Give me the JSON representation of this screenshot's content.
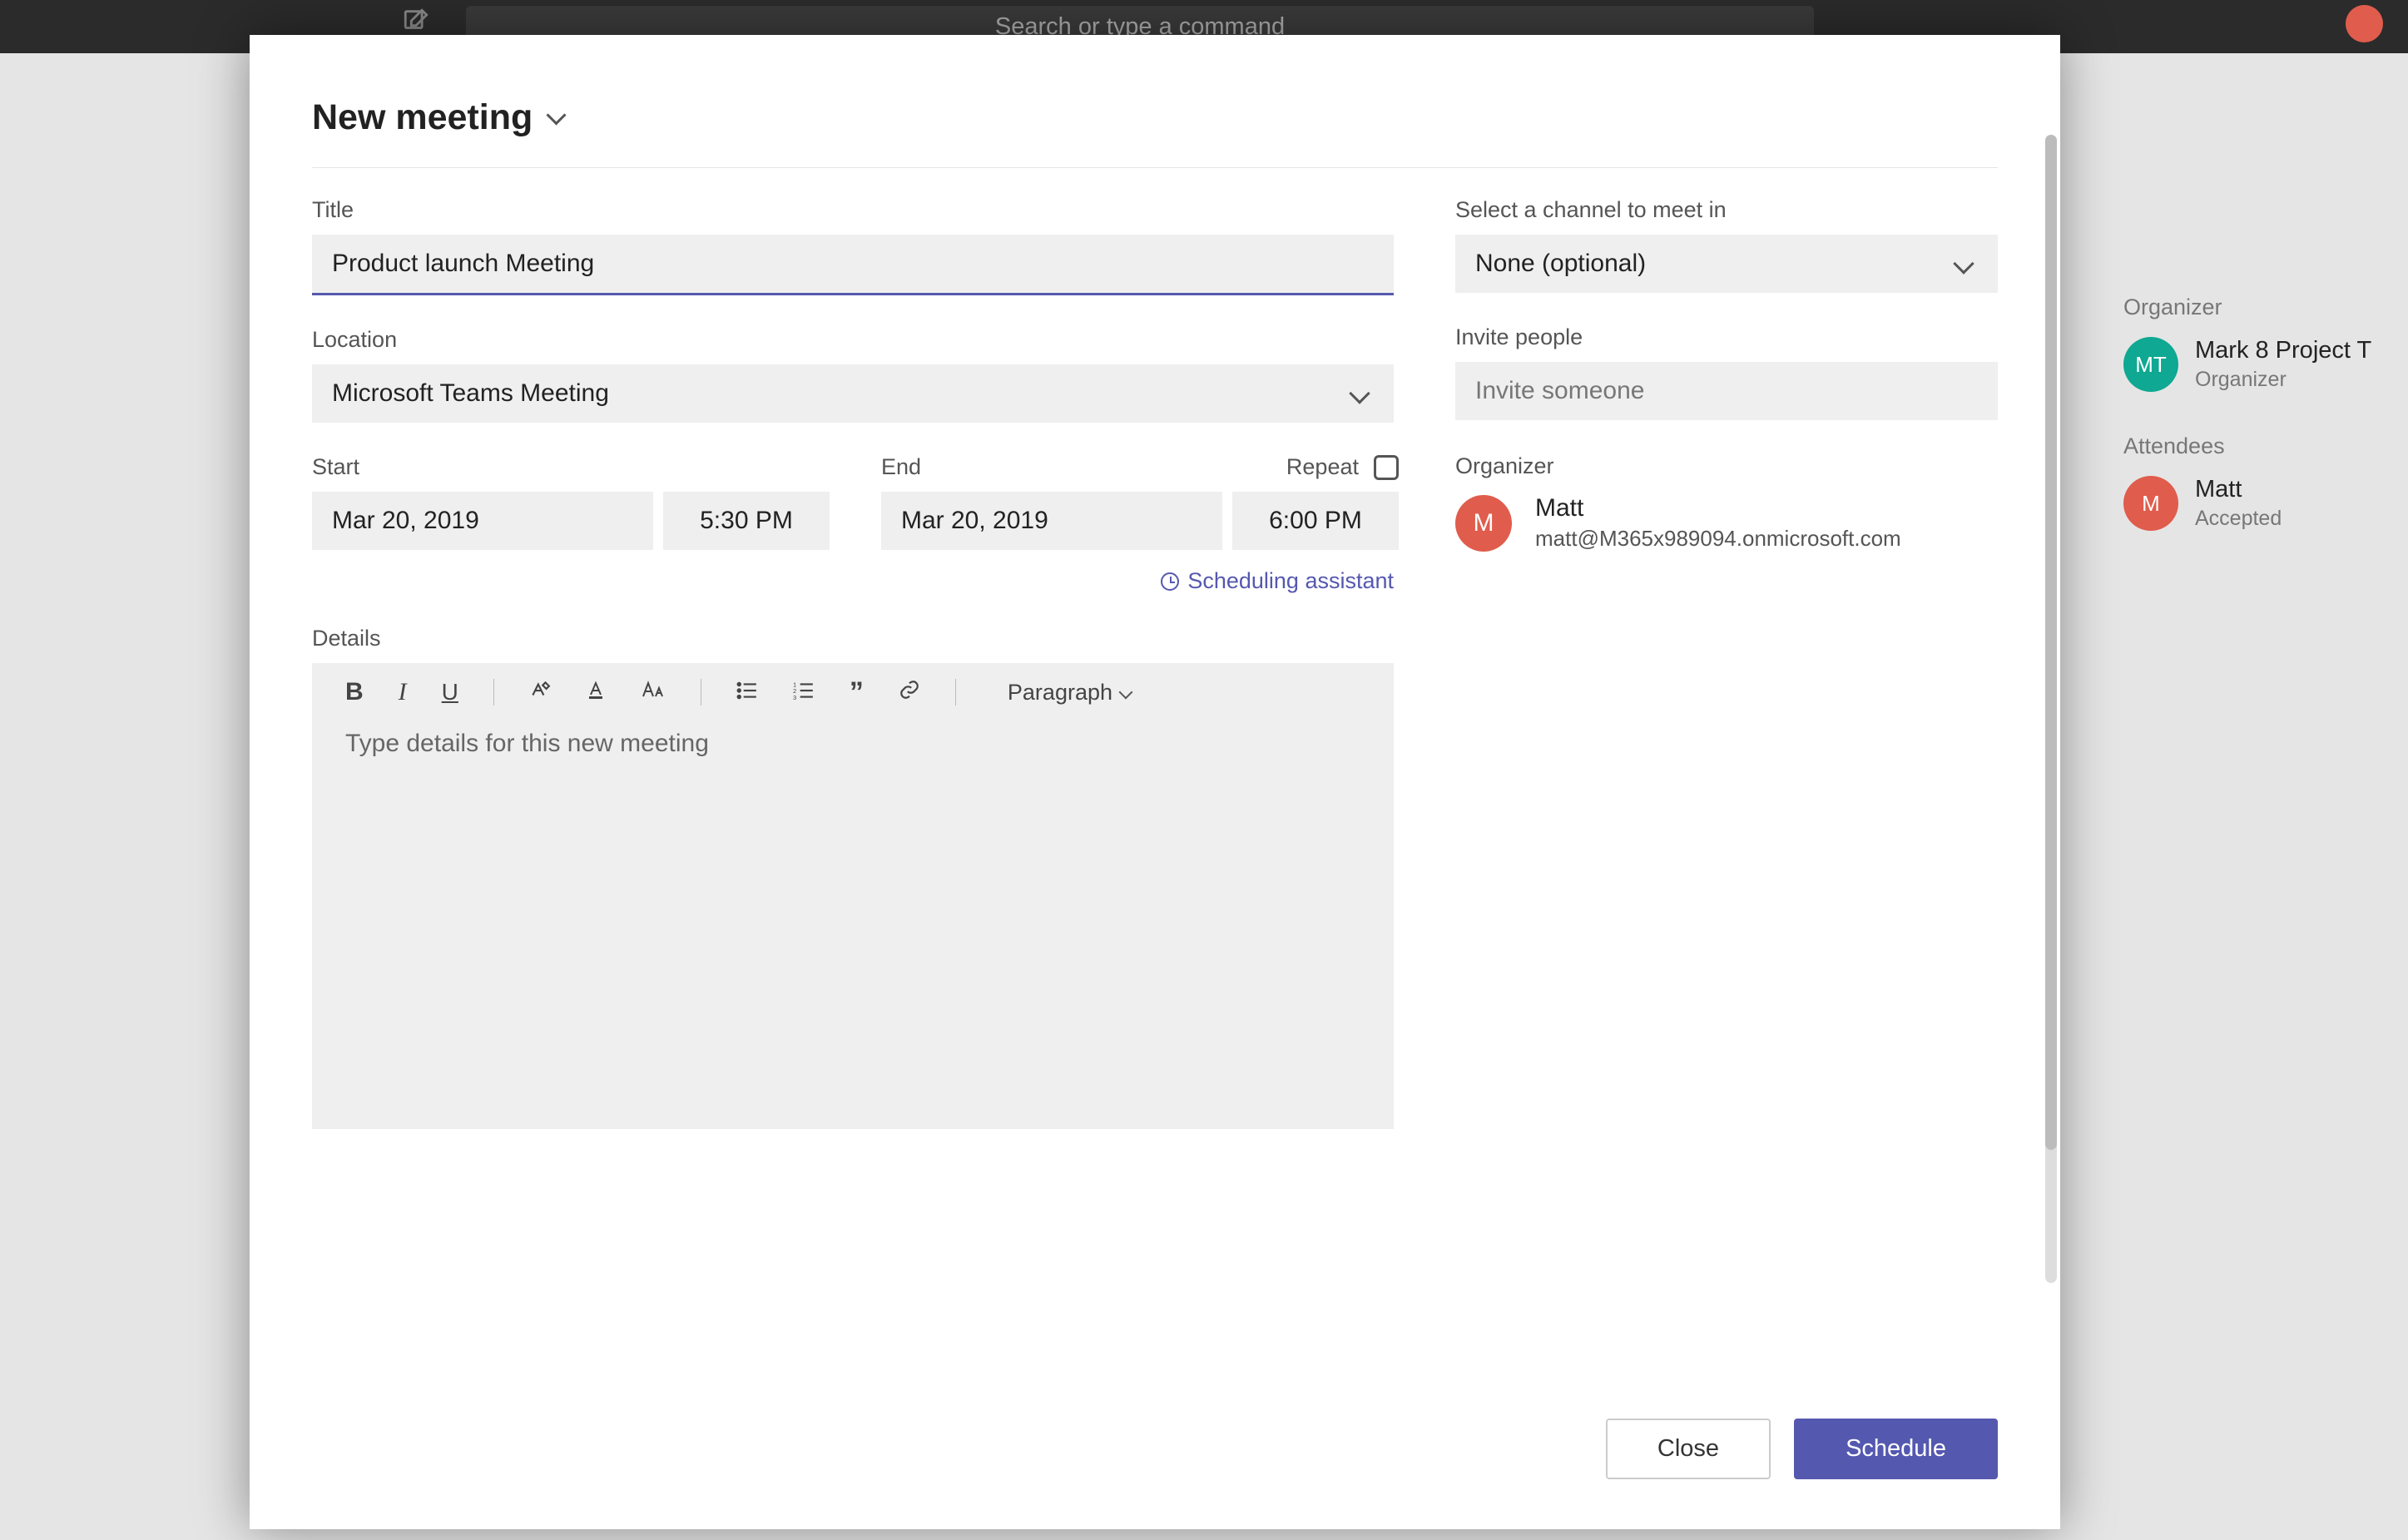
{
  "topbar": {
    "search_placeholder": "Search or type a command"
  },
  "modal": {
    "title": "New meeting",
    "fields": {
      "title_label": "Title",
      "title_value": "Product launch Meeting",
      "location_label": "Location",
      "location_value": "Microsoft Teams Meeting",
      "start_label": "Start",
      "start_date": "Mar 20, 2019",
      "start_time": "5:30 PM",
      "end_label": "End",
      "end_date": "Mar 20, 2019",
      "end_time": "6:00 PM",
      "repeat_label": "Repeat",
      "sched_assist": "Scheduling assistant",
      "details_label": "Details",
      "details_placeholder": "Type details for this new meeting",
      "channel_label": "Select a channel to meet in",
      "channel_value": "None (optional)",
      "invite_label": "Invite people",
      "invite_placeholder": "Invite someone",
      "organizer_label": "Organizer",
      "organizer_name": "Matt",
      "organizer_email": "matt@M365x989094.onmicrosoft.com",
      "organizer_initial": "M"
    },
    "toolbar": {
      "bold": "B",
      "italic": "I",
      "underline": "U",
      "paragraph": "Paragraph"
    },
    "footer": {
      "close": "Close",
      "schedule": "Schedule"
    }
  },
  "sidebar": {
    "organizer_label": "Organizer",
    "org_initials": "MT",
    "org_name": "Mark 8 Project T",
    "org_sub": "Organizer",
    "attendees_label": "Attendees",
    "att_initial": "M",
    "att_name": "Matt",
    "att_sub": "Accepted"
  }
}
